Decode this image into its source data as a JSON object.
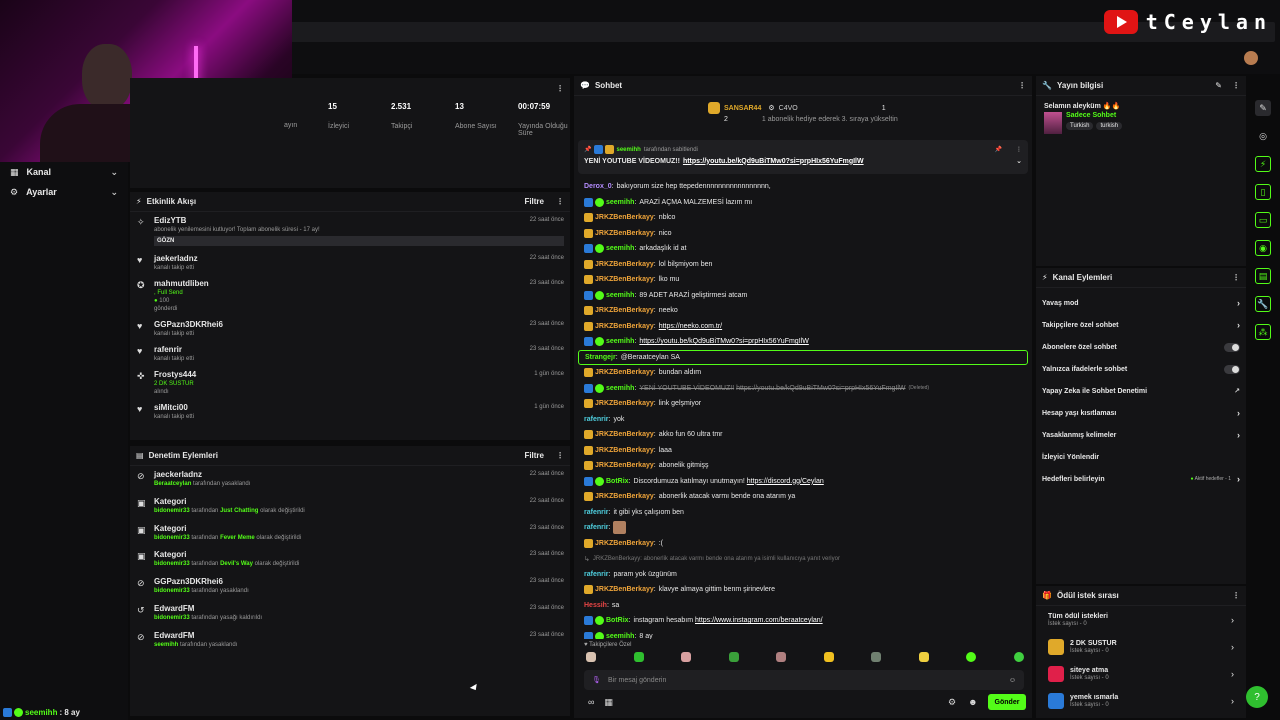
{
  "brand": {
    "name": "tCeylan"
  },
  "sidebar": {
    "items": [
      {
        "label": "Kanal"
      },
      {
        "label": "Ayarlar"
      }
    ]
  },
  "bottom_user": {
    "name": "seemihh",
    "text": ": 8 ay"
  },
  "stats": [
    {
      "value": "",
      "label": "ayın"
    },
    {
      "value": "15",
      "label": "İzleyici"
    },
    {
      "value": "2.531",
      "label": "Takipçi"
    },
    {
      "value": "13",
      "label": "Abone Sayısı"
    },
    {
      "value": "00:07:59",
      "label": "Yayında Olduğu Süre"
    }
  ],
  "activity": {
    "title": "Etkinlik Akışı",
    "filter": "Filtre",
    "items": [
      {
        "icon": "gift-icon",
        "name": "EdizYTB",
        "sub": "abonelik yenilemesini kutluyor! Toplam abonelik süresi - 17 ay!",
        "tag": "GÖZN",
        "time": "22 saat önce"
      },
      {
        "icon": "heart-icon",
        "name": "jaekerladnz",
        "sub": "kanalı takip etti",
        "time": "22 saat önce"
      },
      {
        "icon": "kick-icon",
        "name": "mahmutdliben",
        "sub": ", Full Send",
        "extra": "100",
        "extra2": "gönderdi",
        "time": "23 saat önce"
      },
      {
        "icon": "heart-icon",
        "name": "GGPazn3DKRhei6",
        "sub": "kanalı takip etti",
        "time": "23 saat önce"
      },
      {
        "icon": "heart-icon",
        "name": "rafenrir",
        "sub": "kanalı takip etti",
        "time": "23 saat önce"
      },
      {
        "icon": "reward-icon",
        "name": "Frostys444",
        "sub": "2 DK SUSTUR",
        "sub2": "alındı",
        "time": "1 gün önce"
      },
      {
        "icon": "heart-icon",
        "name": "siMitci00",
        "sub": "kanalı takip etti",
        "time": "1 gün önce"
      }
    ]
  },
  "moderation": {
    "title": "Denetim Eylemleri",
    "filter": "Filtre",
    "items": [
      {
        "icon": "ban-icon",
        "name": "jaeckerladnz",
        "by": "Beraatceylan",
        "action": "tarafından yasaklandı",
        "time": "22 saat önce"
      },
      {
        "icon": "category-icon",
        "name": "Kategori",
        "by": "bidonemir33",
        "action": "tarafından",
        "target": "Just Chatting",
        "action2": "olarak değiştirildi",
        "time": "22 saat önce"
      },
      {
        "icon": "category-icon",
        "name": "Kategori",
        "by": "bidonemir33",
        "action": "tarafından",
        "target": "Fever Meme",
        "action2": "olarak değiştirildi",
        "time": "23 saat önce"
      },
      {
        "icon": "category-icon",
        "name": "Kategori",
        "by": "bidonemir33",
        "action": "tarafından",
        "target": "Devil's Way",
        "action2": "olarak değiştirildi",
        "time": "23 saat önce"
      },
      {
        "icon": "ban-icon",
        "name": "GGPazn3DKRhei6",
        "by": "bidonemir33",
        "action": "tarafından yasaklandı",
        "time": "23 saat önce"
      },
      {
        "icon": "unban-icon",
        "name": "EdwardFM",
        "by": "bidonemir33",
        "action": "tarafından yasağı kaldırıldı",
        "time": "23 saat önce"
      },
      {
        "icon": "ban-icon",
        "name": "EdwardFM",
        "by": "seemihh",
        "action": "tarafından yasaklandı",
        "time": "23 saat önce"
      }
    ]
  },
  "chat": {
    "title": "Sohbet",
    "top": {
      "first": "SANSAR44",
      "first_count": "2",
      "second": "C4VO",
      "second_count": "1",
      "note": "1 abonelik hediye ederek 3. sıraya yükseltin"
    },
    "pinned": {
      "by": "seemihh",
      "by_text": "tarafından sabitlendi",
      "text": "YENİ YOUTUBE VİDEOMUZ!!",
      "link": "https://youtu.be/kQd9uBiTMw0?si=prpHIx56YuFmgIlW"
    },
    "messages": [
      {
        "badges": [],
        "user": "Derox_0",
        "color": "#b48cff",
        "text": "bakıyorum size hep ttepedennnnnnnnnnnnnnnnn,"
      },
      {
        "badges": [
          "mod",
          "sub"
        ],
        "user": "seemihh",
        "color": "#53fc18",
        "text": "ARAZİ AÇMA MALZEMESİ lazım mı"
      },
      {
        "badges": [
          "crown"
        ],
        "user": "JRKZBenBerkayy",
        "color": "#f0a53a",
        "text": "nblco"
      },
      {
        "badges": [
          "crown"
        ],
        "user": "JRKZBenBerkayy",
        "color": "#f0a53a",
        "text": "nico"
      },
      {
        "badges": [
          "mod",
          "sub"
        ],
        "user": "seemihh",
        "color": "#53fc18",
        "text": "arkadaşlık id at"
      },
      {
        "badges": [
          "crown"
        ],
        "user": "JRKZBenBerkayy",
        "color": "#f0a53a",
        "text": "lol bilşmiyom ben"
      },
      {
        "badges": [
          "crown"
        ],
        "user": "JRKZBenBerkayy",
        "color": "#f0a53a",
        "text": "lko mu"
      },
      {
        "badges": [
          "mod",
          "sub"
        ],
        "user": "seemihh",
        "color": "#53fc18",
        "text": "89 ADET ARAZİ geliştirmesi atcam"
      },
      {
        "badges": [
          "crown"
        ],
        "user": "JRKZBenBerkayy",
        "color": "#f0a53a",
        "text": "neeko"
      },
      {
        "badges": [
          "crown"
        ],
        "user": "JRKZBenBerkayy",
        "color": "#f0a53a",
        "link": "https://neeko.com.tr/"
      },
      {
        "badges": [
          "mod",
          "sub"
        ],
        "user": "seemihh",
        "color": "#53fc18",
        "link": "https://youtu.be/kQd9uBiTMw0?si=prpHIx56YuFmgIlW"
      },
      {
        "badges": [],
        "user": "Strangejr",
        "color": "#53fc18",
        "text": "@Beraatceylan SA",
        "highlight": true
      },
      {
        "badges": [
          "crown"
        ],
        "user": "JRKZBenBerkayy",
        "color": "#f0a53a",
        "text": "bundan aldım"
      },
      {
        "badges": [
          "mod",
          "sub"
        ],
        "user": "seemihh",
        "color": "#53fc18",
        "text": "YENİ YOUTUBE VİDEOMUZ!!",
        "strike_link": "https://youtu.be/kQd9uBiTMw0?si=prpHIx56YuFmgIlW",
        "deleted": "(Deleted)"
      },
      {
        "badges": [
          "crown"
        ],
        "user": "JRKZBenBerkayy",
        "color": "#f0a53a",
        "text": "link gelşmiyor"
      },
      {
        "badges": [],
        "user": "rafenrir",
        "color": "#4fd0e0",
        "text": "yok"
      },
      {
        "badges": [
          "crown"
        ],
        "user": "JRKZBenBerkayy",
        "color": "#f0a53a",
        "text": "akko fun 60 ultra tmr"
      },
      {
        "badges": [
          "crown"
        ],
        "user": "JRKZBenBerkayy",
        "color": "#f0a53a",
        "text": "laaa"
      },
      {
        "badges": [
          "crown"
        ],
        "user": "JRKZBenBerkayy",
        "color": "#f0a53a",
        "text": "abonelik gitmişş"
      },
      {
        "badges": [
          "mod",
          "sub"
        ],
        "user": "BotRix",
        "color": "#53fc18",
        "text": "Discordumuza katılmayı unutmayın!",
        "link": "https://discord.gg/Ceylan"
      },
      {
        "badges": [
          "crown"
        ],
        "user": "JRKZBenBerkayy",
        "color": "#f0a53a",
        "text": "abonerlik atacak varmı bende ona atarım ya"
      },
      {
        "badges": [],
        "user": "rafenrir",
        "color": "#4fd0e0",
        "text": "it gibi yks çalışıom ben"
      },
      {
        "badges": [],
        "user": "rafenrir",
        "color": "#4fd0e0",
        "text": "",
        "emote": true
      },
      {
        "badges": [
          "crown"
        ],
        "user": "JRKZBenBerkayy",
        "color": "#f0a53a",
        "text": ":("
      },
      {
        "badges": [],
        "user": "",
        "color": "#888",
        "reply": "JRKZBenBerkayy: abonerlik atacak varmı bende ona atarım ya isimli kullanıcıya yanıt veriyor"
      },
      {
        "badges": [],
        "user": "rafenrir",
        "color": "#4fd0e0",
        "text": "param yok üzgünüm"
      },
      {
        "badges": [
          "crown"
        ],
        "user": "JRKZBenBerkayy",
        "color": "#f0a53a",
        "text": "klavye almaya gittim benm şirinevlere"
      },
      {
        "badges": [],
        "user": "Hessih",
        "color": "#e84545",
        "text": "sa"
      },
      {
        "badges": [
          "mod",
          "sub"
        ],
        "user": "BotRix",
        "color": "#53fc18",
        "text": "instagram hesabım",
        "link": "https://www.instagram.com/beraatceylan/"
      },
      {
        "badges": [
          "mod",
          "sub"
        ],
        "user": "seemihh",
        "color": "#53fc18",
        "text": "8 ay"
      }
    ],
    "followers_only": "Takipçilere Özel",
    "input_placeholder": "Bir mesaj gönderin",
    "send_label": "Gönder"
  },
  "stream_info": {
    "title": "Yayın bilgisi",
    "greeting": "Selamın aleyküm",
    "category": "Sadece Sohbet",
    "tags": [
      "Turkish",
      "turkish"
    ]
  },
  "channel_actions": {
    "title": "Kanal Eylemleri",
    "items": [
      {
        "label": "Yavaş mod",
        "kind": "chevron"
      },
      {
        "label": "Takipçilere özel sohbet",
        "kind": "chevron"
      },
      {
        "label": "Abonelere özel sohbet",
        "kind": "toggle"
      },
      {
        "label": "Yalnızca ifadelerle sohbet",
        "kind": "toggle"
      },
      {
        "label": "Yapay Zeka ile Sohbet Denetimi",
        "kind": "external"
      },
      {
        "label": "Hesap yaşı kısıtlaması",
        "kind": "chevron"
      },
      {
        "label": "Yasaklanmış kelimeler",
        "kind": "chevron"
      },
      {
        "label": "İzleyici Yönlendir",
        "kind": "none"
      },
      {
        "label": "Hedefleri belirleyin",
        "kind": "chevron",
        "note": "Aktif hedefler - 1"
      }
    ]
  },
  "rewards": {
    "title": "Ödül istek sırası",
    "items": [
      {
        "label": "Tüm ödül istekleri",
        "sub": "İstek sayısı - 0",
        "color": ""
      },
      {
        "label": "2 DK SUSTUR",
        "sub": "İstek sayısı - 0",
        "color": "#e0a92a"
      },
      {
        "label": "siteye atma",
        "sub": "İstek sayısı - 0",
        "color": "#e0204a"
      },
      {
        "label": "yemek ısmarla",
        "sub": "İstek sayısı - 0",
        "color": "#2a7ad8"
      }
    ]
  }
}
